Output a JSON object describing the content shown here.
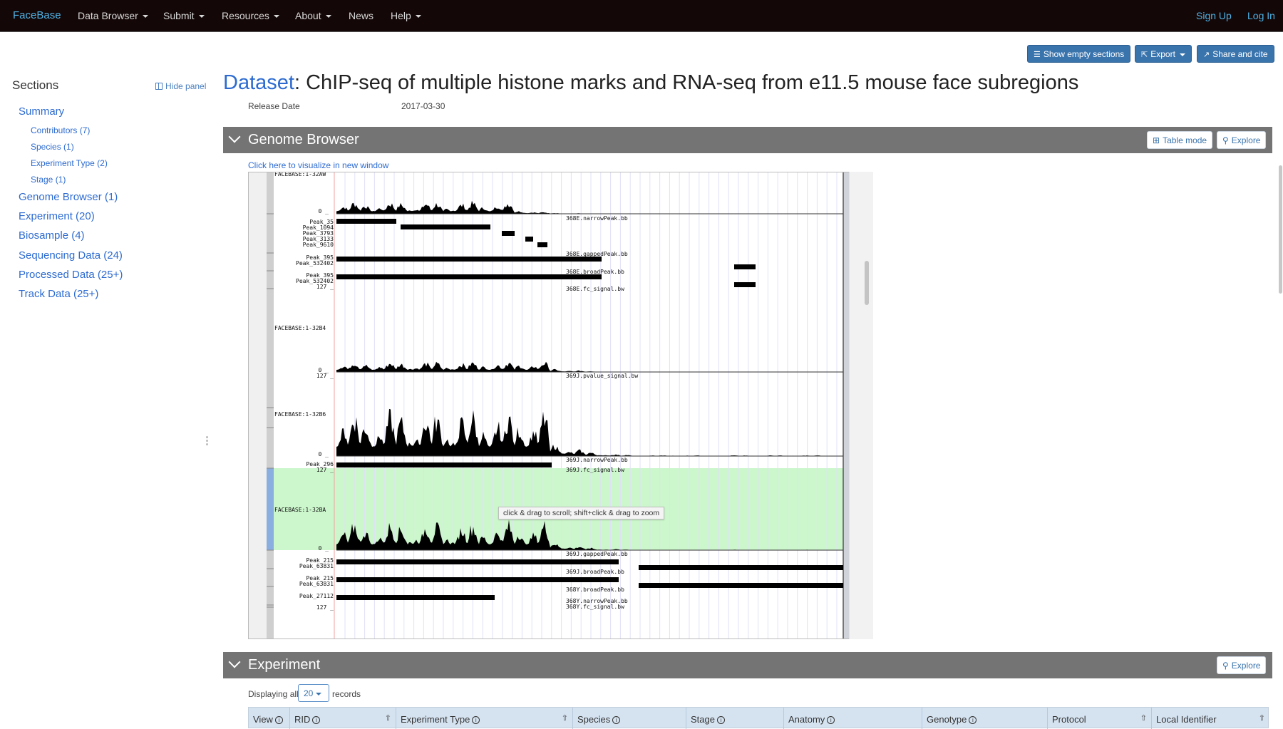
{
  "navbar": {
    "brand": "FaceBase",
    "items": [
      {
        "label": "Data Browser",
        "dropdown": true
      },
      {
        "label": "Submit",
        "dropdown": true
      },
      {
        "label": "Resources",
        "dropdown": true
      },
      {
        "label": "About",
        "dropdown": true
      },
      {
        "label": "News",
        "dropdown": false
      },
      {
        "label": "Help",
        "dropdown": true
      }
    ],
    "right": [
      {
        "label": "Sign Up"
      },
      {
        "label": "Log In"
      }
    ]
  },
  "actions": {
    "show_empty": {
      "label": "Show empty sections",
      "icon": "list-icon"
    },
    "export": {
      "label": "Export",
      "icon": "export-icon"
    },
    "share": {
      "label": "Share and cite",
      "icon": "share-icon"
    }
  },
  "sidebar": {
    "title": "Sections",
    "hide_panel": "Hide panel",
    "items": [
      {
        "label": "Summary",
        "level": 1
      },
      {
        "label": "Contributors (7)",
        "level": 2
      },
      {
        "label": "Species (1)",
        "level": 2
      },
      {
        "label": "Experiment Type (2)",
        "level": 2
      },
      {
        "label": "Stage (1)",
        "level": 2
      },
      {
        "label": "Genome Browser (1)",
        "level": 1
      },
      {
        "label": "Experiment (20)",
        "level": 1
      },
      {
        "label": "Biosample (4)",
        "level": 1
      },
      {
        "label": "Sequencing Data (24)",
        "level": 1
      },
      {
        "label": "Processed Data (25+)",
        "level": 1
      },
      {
        "label": "Track Data (25+)",
        "level": 1
      }
    ]
  },
  "page": {
    "title_prefix": "Dataset",
    "title_sep": ": ",
    "title": "ChIP-seq of multiple histone marks and RNA-seq from e11.5 mouse face subregions",
    "release_label": "Release Date",
    "release_value": "2017-03-30"
  },
  "genome_browser": {
    "section_title": "Genome Browser",
    "table_mode": "Table mode",
    "explore": "Explore",
    "viz_link": "Click here to visualize in new window",
    "tooltip": "click & drag to scroll; shift+click & drag to zoom",
    "track_labels": [
      "FACEBASE:1-32AW",
      "FACEBASE:1-32B4",
      "FACEBASE:1-32B6",
      "FACEBASE:1-32BA"
    ],
    "file_labels": [
      "368E.narrowPeak.bb",
      "368E.gappedPeak.bb",
      "368E.broadPeak.bb",
      "368E.fc_signal.bw",
      "369J.pvalue_signal.bw",
      "369J.narrowPeak.bb",
      "369J.fc_signal.bw",
      "369J.gappedPeak.bb",
      "369J.broadPeak.bb",
      "368Y.broadPeak.bb",
      "368Y.narrowPeak.bb",
      "368Y.fc_signal.bw"
    ],
    "peak_labels": [
      "Peak_35",
      "Peak_1094",
      "Peak_3793",
      "Peak_3133",
      "Peak_9610",
      "Peak_395",
      "Peak_532402",
      "Peak_395",
      "Peak_532402",
      "Peak_296",
      "Peak_215",
      "Peak_63831",
      "Peak_215",
      "Peak_63831",
      "Peak_27112"
    ],
    "scale_labels": {
      "zero": "0",
      "max": "127"
    },
    "highlight_color": "#ccf7cc"
  },
  "experiment": {
    "section_title": "Experiment",
    "explore": "Explore",
    "displaying_prefix": "Displaying all",
    "page_size": "20",
    "displaying_suffix": "records",
    "columns": [
      {
        "label": "View",
        "info": true,
        "sortable": false
      },
      {
        "label": "RID",
        "info": true,
        "sortable": true
      },
      {
        "label": "Experiment Type",
        "info": true,
        "sortable": true
      },
      {
        "label": "Species",
        "info": true,
        "sortable": false
      },
      {
        "label": "Stage",
        "info": true,
        "sortable": false
      },
      {
        "label": "Anatomy",
        "info": true,
        "sortable": false
      },
      {
        "label": "Genotype",
        "info": true,
        "sortable": false
      },
      {
        "label": "Protocol",
        "info": false,
        "sortable": true
      },
      {
        "label": "Local Identifier",
        "info": false,
        "sortable": true
      }
    ]
  },
  "colors": {
    "navbar_bg": "#140707",
    "brand": "#4fb3e6",
    "link": "#2d6bd0",
    "primary_button": "#3a74ad",
    "section_bar": "#747474",
    "table_header": "#d5e3f1"
  }
}
